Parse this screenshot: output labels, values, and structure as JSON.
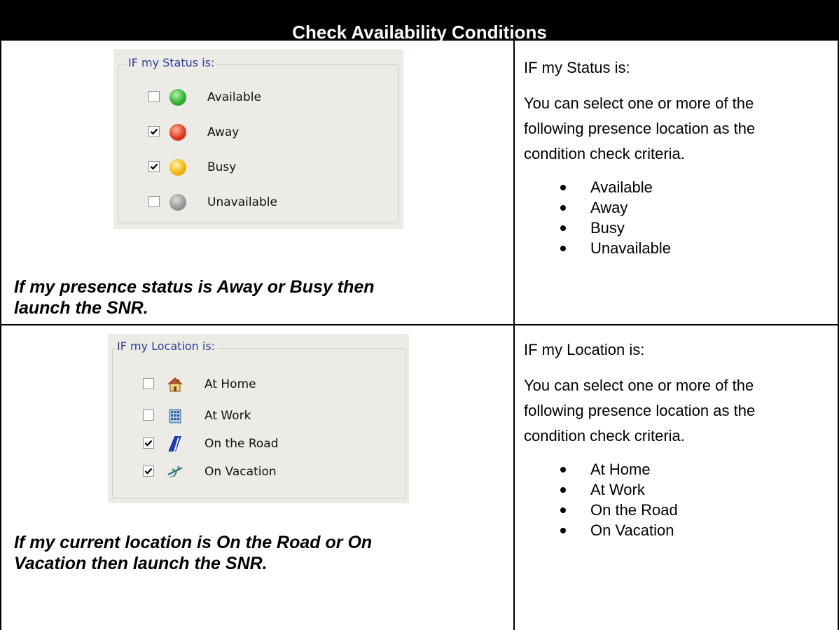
{
  "header": {
    "title": "Check Availability Conditions"
  },
  "status_section": {
    "group_label": "IF my Status is:",
    "options": [
      {
        "label": "Available",
        "checked": false,
        "color": "#33b233"
      },
      {
        "label": "Away",
        "checked": true,
        "color": "#e23b1e"
      },
      {
        "label": "Busy",
        "checked": true,
        "color": "#f2b80f"
      },
      {
        "label": "Unavailable",
        "checked": false,
        "color": "#9a9a9a"
      }
    ],
    "caption_line1": "If my presence status is Away or Busy then",
    "caption_line2": "launch the SNR.",
    "description_title": "IF my Status is:",
    "description_line1": "You can select one or more of the",
    "description_line2": "following presence location as the",
    "description_line3": "condition check criteria.",
    "bullets": [
      "Available",
      "Away",
      "Busy",
      "Unavailable"
    ]
  },
  "location_section": {
    "group_label": "IF my Location is:",
    "options": [
      {
        "label": "At Home",
        "checked": false,
        "icon": "house-icon"
      },
      {
        "label": "At Work",
        "checked": false,
        "icon": "office-building-icon"
      },
      {
        "label": "On the Road",
        "checked": true,
        "icon": "road-icon"
      },
      {
        "label": "On Vacation",
        "checked": true,
        "icon": "airplane-icon"
      }
    ],
    "caption_line1": "If my current location is On the Road or On",
    "caption_line2": "Vacation then launch the SNR.",
    "description_title": "IF my Location is:",
    "description_line1": "You can select one or more of the",
    "description_line2": "following presence location as the",
    "description_line3": "condition check criteria.",
    "bullets": [
      "At Home",
      "At Work",
      "On the Road",
      "On Vacation"
    ]
  }
}
